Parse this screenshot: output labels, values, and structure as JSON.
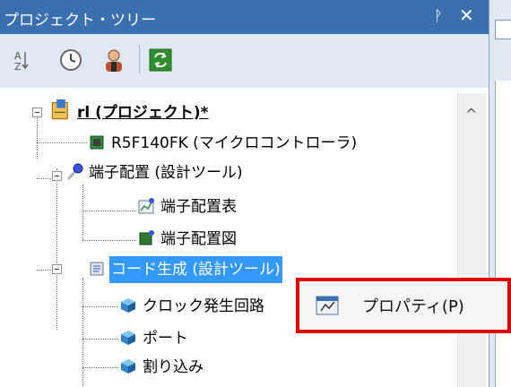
{
  "panel": {
    "title": "プロジェクト・ツリー",
    "pin_symbol": "ᚹ",
    "close_symbol": "✕"
  },
  "toolbar": {
    "items": [
      "sort-icon",
      "clock-icon",
      "person-icon",
      "refresh-icon"
    ]
  },
  "tree": {
    "root": "rl (プロジェクト)*",
    "device": "R5F140FK (マイクロコントローラ)",
    "pin_config": "端子配置 (設計ツール)",
    "pin_table": "端子配置表",
    "pin_diagram": "端子配置図",
    "code_gen": "コード生成 (設計ツール)",
    "clock": "クロック発生回路",
    "port": "ポート",
    "interrupt": "割り込み"
  },
  "context_menu": {
    "properties": "プロパティ(P)"
  },
  "scrollbar": {
    "up": "^"
  },
  "colors": {
    "titlebar": "#3a6fb0",
    "selection": "#3399ff",
    "highlight_box": "#e00000"
  }
}
